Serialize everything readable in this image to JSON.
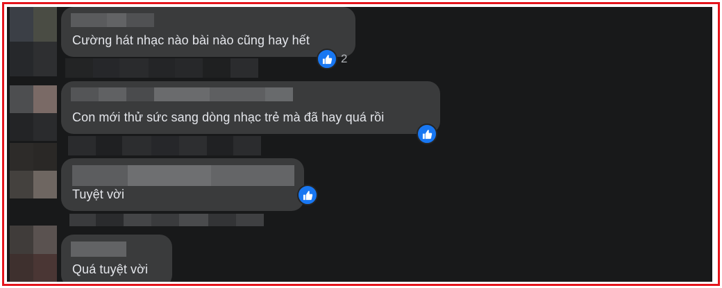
{
  "colors": {
    "frame_border": "#e4141c",
    "background": "#18191a",
    "bubble": "#3a3b3c",
    "text": "#e4e6eb",
    "like_blue": "#1877f2",
    "muted": "#b0b3b8"
  },
  "comments": [
    {
      "text": "Cường hát nhạc nào bài nào cũng hay hết",
      "reaction_icon": "like-icon",
      "reaction_count": "2"
    },
    {
      "text": "Con mới thử sức sang dòng nhạc trẻ mà đã hay quá rồi",
      "reaction_icon": "like-icon",
      "reaction_count": ""
    },
    {
      "text": "Tuyệt vời",
      "reaction_icon": "like-icon",
      "reaction_count": ""
    },
    {
      "text": "Quá tuyệt vời",
      "reaction_icon": "",
      "reaction_count": ""
    }
  ]
}
